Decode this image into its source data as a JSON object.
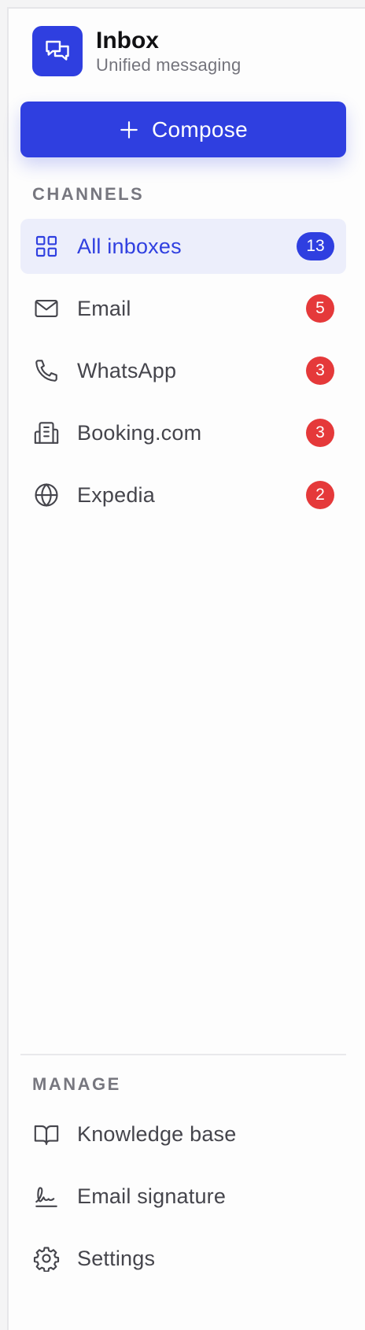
{
  "brand": {
    "title": "Inbox",
    "subtitle": "Unified messaging",
    "icon": "chat-bubbles-icon",
    "color": "#2f3fe0"
  },
  "compose": {
    "label": "Compose",
    "icon": "plus-icon"
  },
  "channels": {
    "heading": "CHANNELS",
    "items": [
      {
        "label": "All inboxes",
        "count": "13",
        "icon": "grid-icon",
        "active": true,
        "badge_color": "#2f3fe0"
      },
      {
        "label": "Email",
        "count": "5",
        "icon": "mail-icon",
        "active": false,
        "badge_color": "#e5393a"
      },
      {
        "label": "WhatsApp",
        "count": "3",
        "icon": "phone-icon",
        "active": false,
        "badge_color": "#e5393a"
      },
      {
        "label": "Booking.com",
        "count": "3",
        "icon": "building-icon",
        "active": false,
        "badge_color": "#e5393a"
      },
      {
        "label": "Expedia",
        "count": "2",
        "icon": "globe-icon",
        "active": false,
        "badge_color": "#e5393a"
      }
    ]
  },
  "manage": {
    "heading": "MANAGE",
    "items": [
      {
        "label": "Knowledge base",
        "icon": "book-open-icon"
      },
      {
        "label": "Email signature",
        "icon": "signature-icon"
      },
      {
        "label": "Settings",
        "icon": "gear-icon"
      }
    ]
  },
  "colors": {
    "accent": "#2f3fe0",
    "badge_alert": "#e5393a",
    "active_bg": "#eceefb"
  }
}
